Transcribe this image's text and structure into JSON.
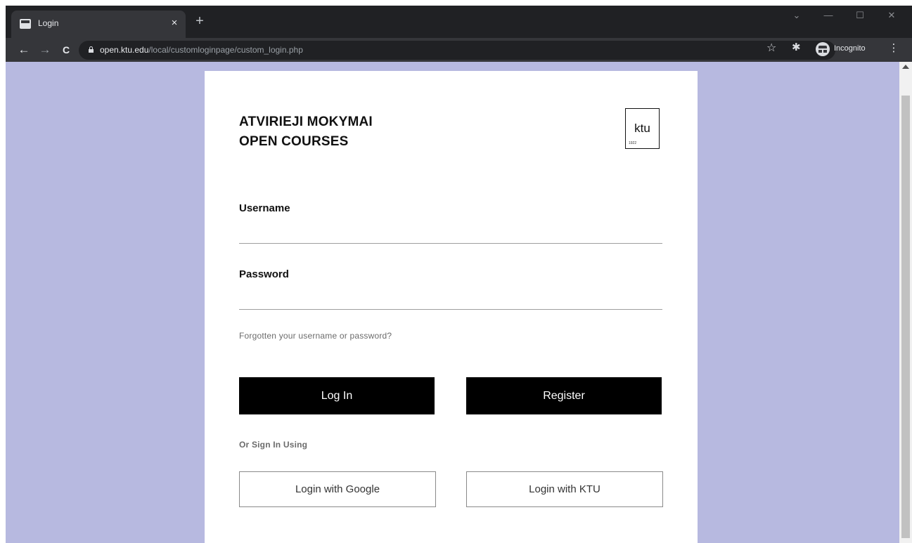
{
  "browser": {
    "tab_title": "Login",
    "tab_close": "×",
    "new_tab": "+",
    "url_host": "open.ktu.edu",
    "url_path": "/local/customloginpage/custom_login.php",
    "profile_label": "Incognito",
    "nav": {
      "back": "←",
      "forward": "→",
      "reload": "C"
    },
    "window_controls": {
      "dropdown": "⌄",
      "minimize": "—",
      "maximize": "☐",
      "close": "✕"
    },
    "star": "☆",
    "extensions": "✱",
    "menu": "⋮"
  },
  "page": {
    "background_color": "#b7b9e0",
    "brand_line1": "ATVIRIEJI MOKYMAI",
    "brand_line2": "OPEN COURSES",
    "logo_text": "ktu",
    "logo_small": "1922",
    "username_label": "Username",
    "username_value": "",
    "password_label": "Password",
    "password_value": "",
    "forgot_link": "Forgotten your username or password?",
    "login_button": "Log In",
    "register_button": "Register",
    "or_sign_in": "Or Sign In Using",
    "google_button": "Login with Google",
    "ktu_button": "Login with KTU"
  }
}
